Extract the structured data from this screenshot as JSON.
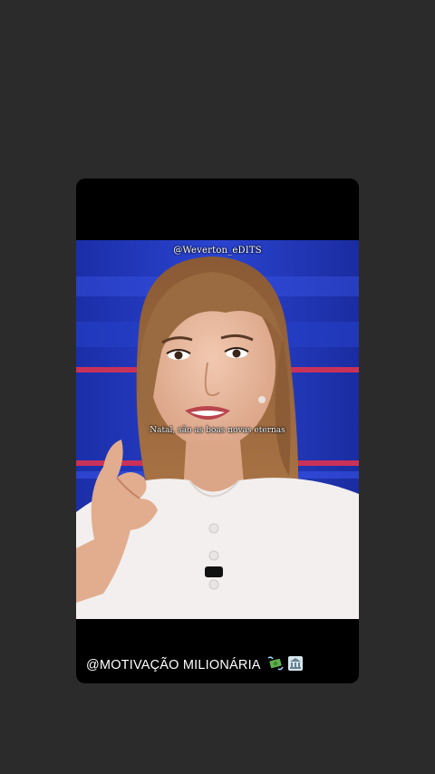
{
  "video": {
    "watermark": "@Weverton_eDITS",
    "subtitle": "Natal, são as boas novas eternas"
  },
  "caption": {
    "text": "@MOTIVAÇÃO MILIONÁRIA",
    "icons": [
      "money-with-wings-icon",
      "bank-icon"
    ]
  },
  "colors": {
    "background": "#2b2b2b",
    "card": "#000000",
    "studio_blue": "#1a2fb0",
    "stripe_red": "#c8325a",
    "text": "#ffffff"
  }
}
